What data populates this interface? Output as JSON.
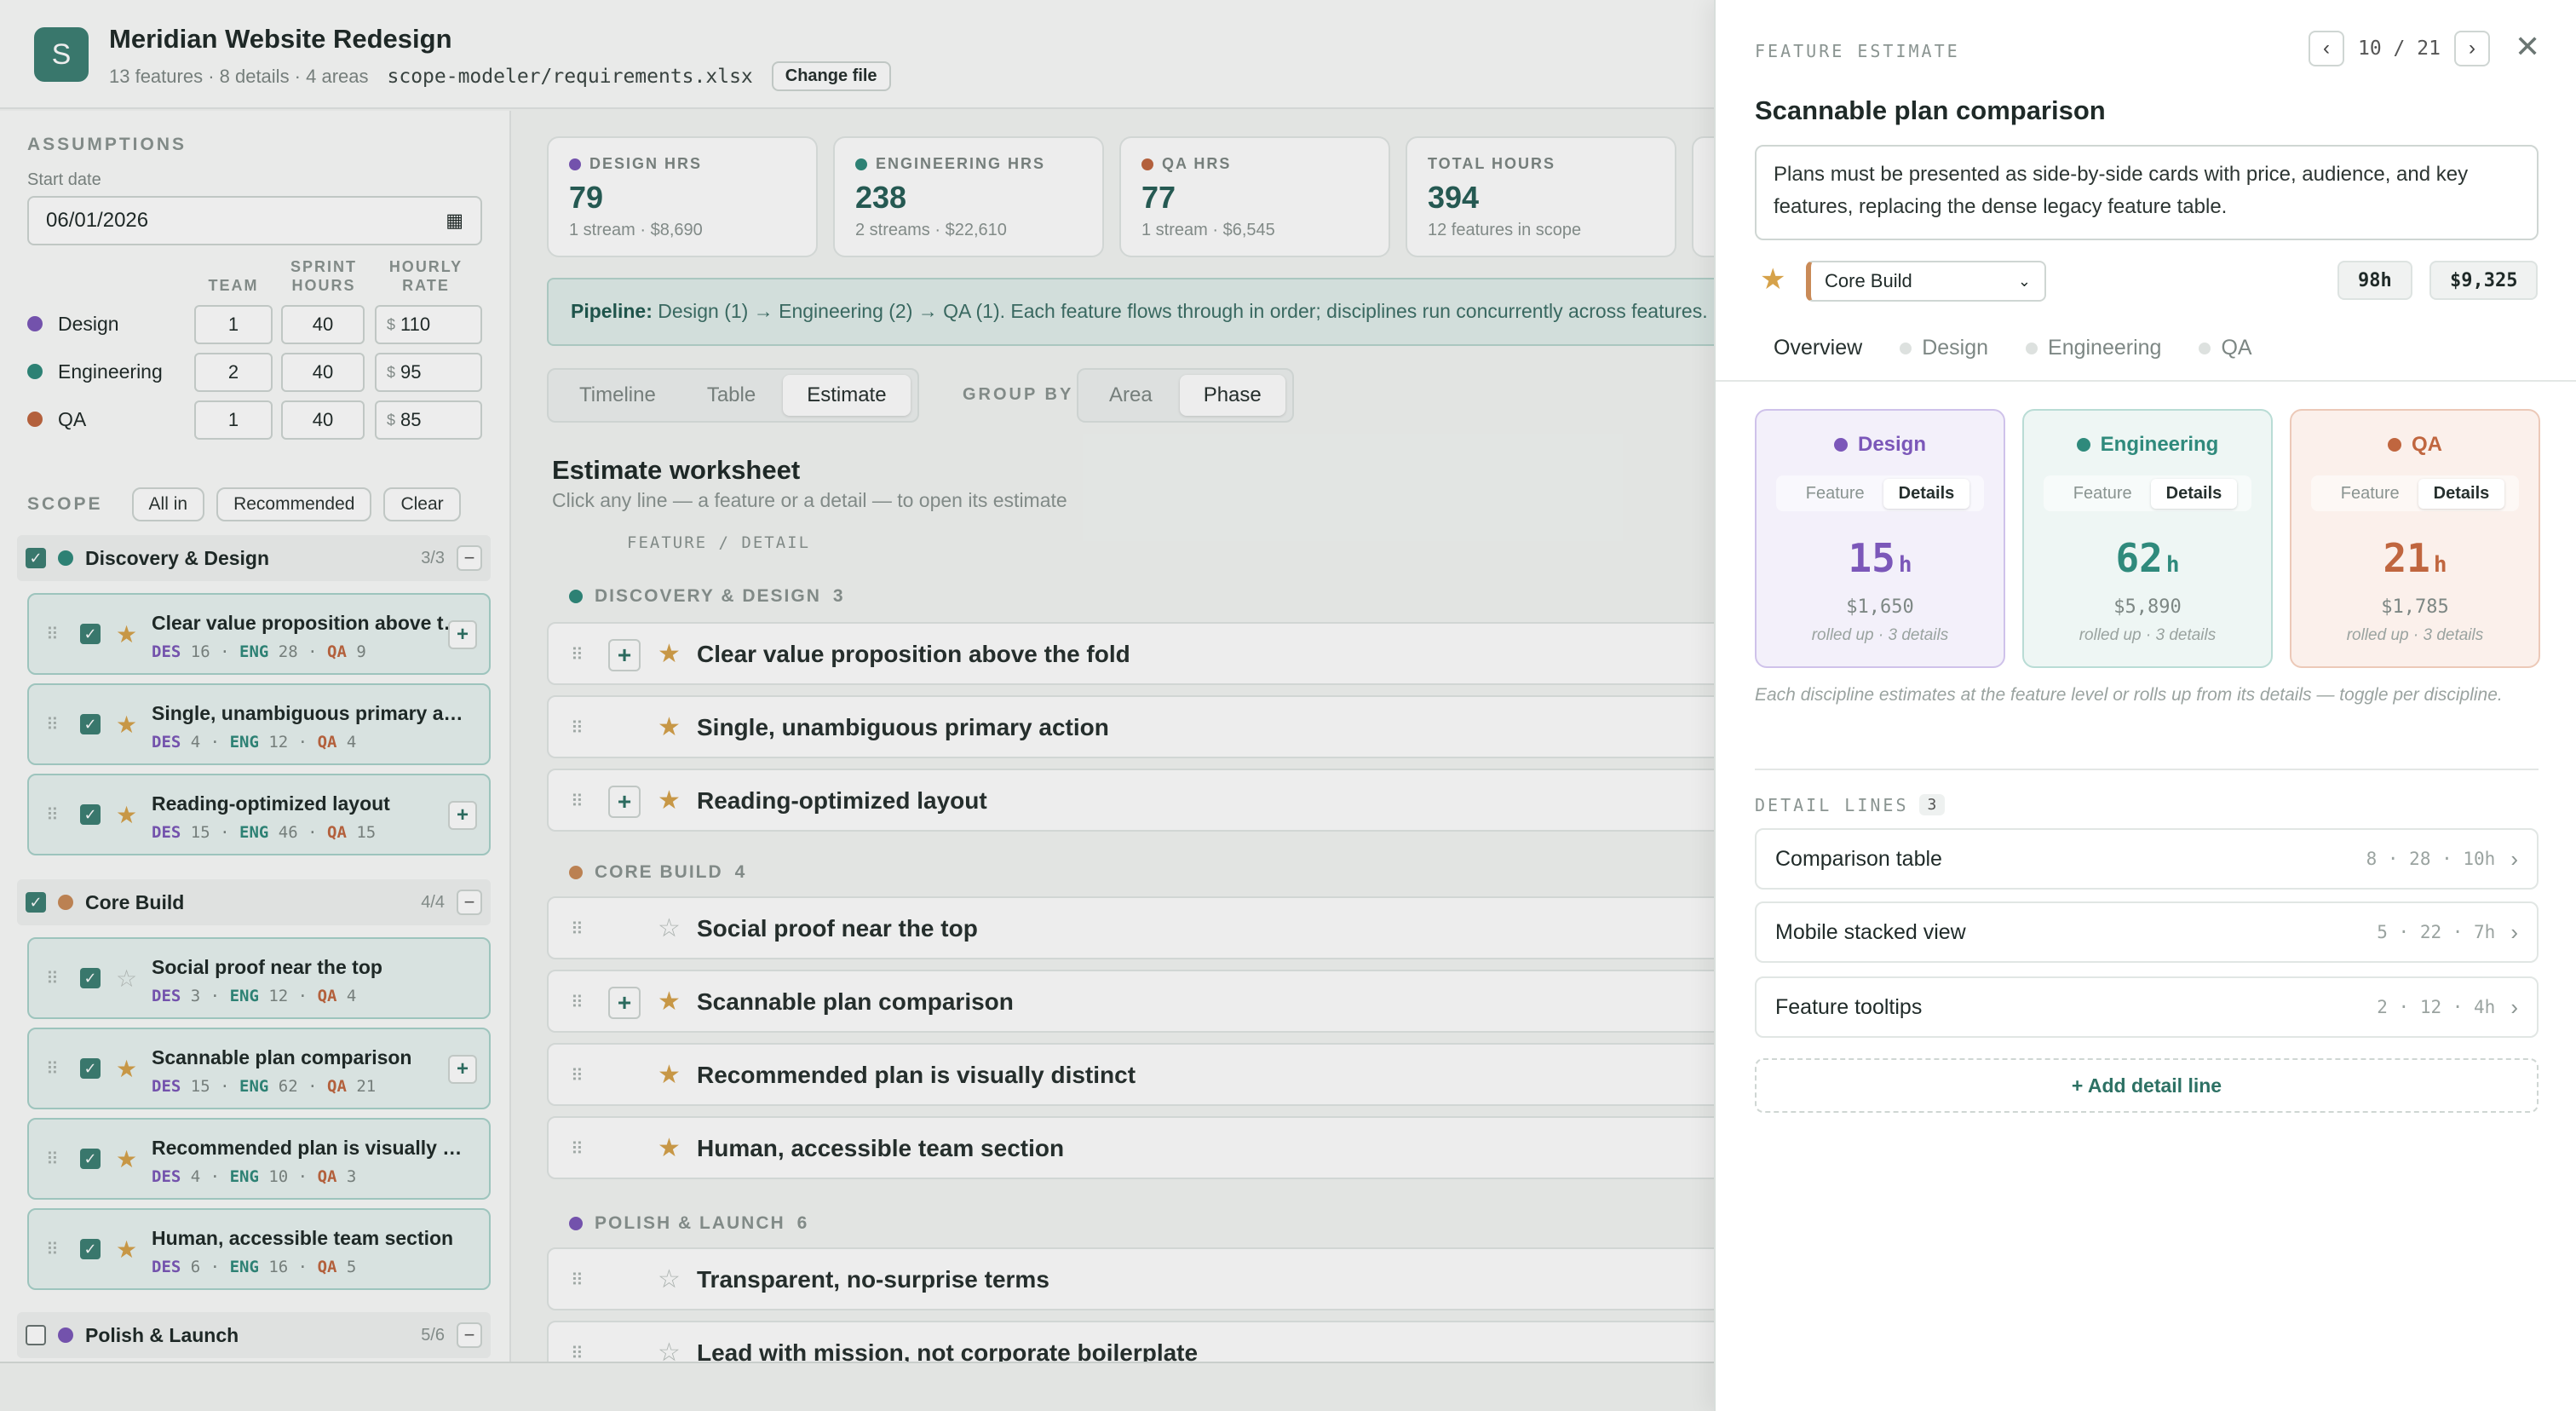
{
  "app": {
    "logo_letter": "S",
    "title": "Meridian Website Redesign",
    "subtitle": "13 features · 8 details · 4 areas",
    "file_path": "scope-modeler/requirements.xlsx",
    "change_file": "Change file"
  },
  "assumptions": {
    "label": "ASSUMPTIONS",
    "start_label": "Start date",
    "start_value": "06/01/2026",
    "col_team": "TEAM",
    "col_sprint": "SPRINT HOURS",
    "col_rate": "HOURLY RATE",
    "rate_symbol": "$",
    "roles": [
      {
        "name": "Design",
        "team": "1",
        "sprint": "40",
        "rate": "110",
        "color": "#7b57b9"
      },
      {
        "name": "Engineering",
        "team": "2",
        "sprint": "40",
        "rate": "95",
        "color": "#2f8a7c"
      },
      {
        "name": "QA",
        "team": "1",
        "sprint": "40",
        "rate": "85",
        "color": "#c0663f"
      }
    ]
  },
  "scope": {
    "label": "SCOPE",
    "chips": [
      "All in",
      "Recommended",
      "Clear"
    ],
    "groups": [
      {
        "name": "Discovery & Design",
        "count": "3/3",
        "color": "#2f8a7c"
      },
      {
        "name": "Core Build",
        "count": "4/4",
        "color": "#c98a57"
      },
      {
        "name": "Polish & Launch",
        "count": "5/6",
        "color": "#7b57b9"
      }
    ],
    "features": [
      {
        "name": "Clear value proposition above the fold",
        "des": "16",
        "eng": "28",
        "qa": "9"
      },
      {
        "name": "Single, unambiguous primary action",
        "des": "4",
        "eng": "12",
        "qa": "4"
      },
      {
        "name": "Reading-optimized layout",
        "des": "15",
        "eng": "46",
        "qa": "15"
      },
      {
        "name": "Social proof near the top",
        "des": "3",
        "eng": "12",
        "qa": "4"
      },
      {
        "name": "Scannable plan comparison",
        "des": "15",
        "eng": "62",
        "qa": "21"
      },
      {
        "name": "Recommended plan is visually distinct",
        "des": "4",
        "eng": "10",
        "qa": "3"
      },
      {
        "name": "Human, accessible team section",
        "des": "6",
        "eng": "16",
        "qa": "5"
      }
    ],
    "meta_des": "DES",
    "meta_eng": "ENG",
    "meta_qa": "QA"
  },
  "stats": [
    {
      "label": "DESIGN HRS",
      "value": "79",
      "sub": "1 stream · $8,690",
      "color": "#7b57b9"
    },
    {
      "label": "ENGINEERING HRS",
      "value": "238",
      "sub": "2 streams · $22,610",
      "color": "#2f8a7c"
    },
    {
      "label": "QA HRS",
      "value": "77",
      "sub": "1 stream · $6,545",
      "color": "#c0663f"
    },
    {
      "label": "TOTAL HOURS",
      "value": "394",
      "sub": "12 features in scope"
    }
  ],
  "pipeline": {
    "label": "Pipeline:",
    "text": "Design (1) → Engineering (2) → QA (1). Each feature flows through in order; disciplines run concurrently across features."
  },
  "views": [
    "Timeline",
    "Table",
    "Estimate"
  ],
  "group_by": {
    "label": "GROUP BY",
    "options": [
      "Area",
      "Phase"
    ]
  },
  "worksheet": {
    "title": "Estimate worksheet",
    "subtitle": "Click any line — a feature or a detail — to open its estimate",
    "col": "FEATURE / DETAIL",
    "sections": [
      {
        "name": "DISCOVERY & DESIGN",
        "count": "3",
        "color": "#2f8a7c"
      },
      {
        "name": "CORE BUILD",
        "count": "4",
        "color": "#c98a57"
      },
      {
        "name": "POLISH & LAUNCH",
        "count": "6",
        "color": "#7b57b9"
      }
    ],
    "rows": [
      "Clear value proposition above the fold",
      "Single, unambiguous primary action",
      "Reading-optimized layout",
      "Social proof near the top",
      "Scannable plan comparison",
      "Recommended plan is visually distinct",
      "Human, accessible team section",
      "Transparent, no-surprise terms",
      "Lead with mission, not corporate boilerplate"
    ]
  },
  "panel": {
    "label": "FEATURE ESTIMATE",
    "pager": "10 / 21",
    "title": "Scannable plan comparison",
    "description": "Plans must be presented as side-by-side cards with price, audience, and key features, replacing the dense legacy feature table.",
    "phase": "Core Build",
    "hours": "98h",
    "cost": "$9,325",
    "tabs": [
      "Overview",
      "Design",
      "Engineering",
      "QA"
    ],
    "toggle_feature": "Feature",
    "toggle_details": "Details",
    "disciplines": [
      {
        "name": "Design",
        "hours": "15",
        "unit": "h",
        "cost": "$1,650",
        "note": "rolled up · 3 details",
        "color": "#7b57b9"
      },
      {
        "name": "Engineering",
        "hours": "62",
        "unit": "h",
        "cost": "$5,890",
        "note": "rolled up · 3 details",
        "color": "#2f8a7c"
      },
      {
        "name": "QA",
        "hours": "21",
        "unit": "h",
        "cost": "$1,785",
        "note": "rolled up · 3 details",
        "color": "#c0663f"
      }
    ],
    "note": "Each discipline estimates at the feature level or rolls up from its details — toggle per discipline.",
    "detail_label": "DETAIL LINES",
    "detail_count": "3",
    "details": [
      {
        "name": "Comparison table",
        "hours": "8 · 28 · 10h"
      },
      {
        "name": "Mobile stacked view",
        "hours": "5 · 22 · 7h"
      },
      {
        "name": "Feature tooltips",
        "hours": "2 · 12 · 4h"
      }
    ],
    "add_detail": "+ Add detail line"
  }
}
